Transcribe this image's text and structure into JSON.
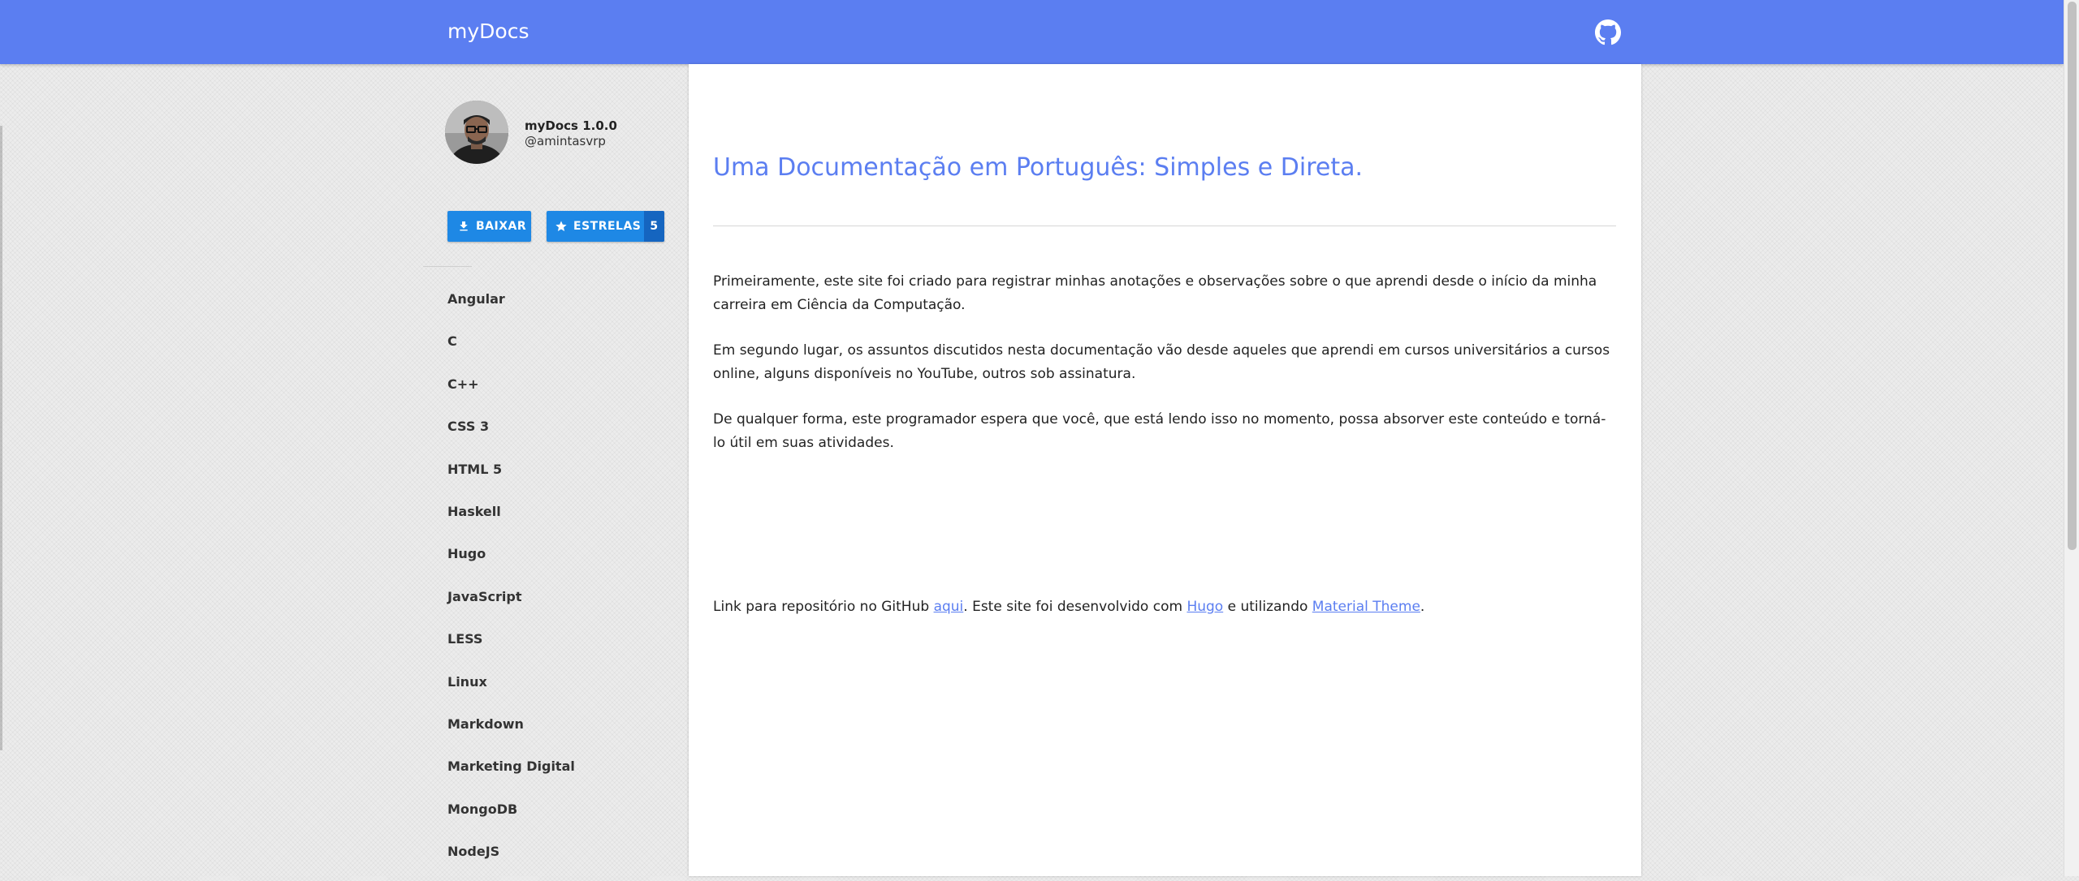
{
  "header": {
    "brand": "myDocs",
    "github_icon": "github-icon",
    "color": "#5b7ef1"
  },
  "sidebar": {
    "project_name": "myDocs 1.0.0",
    "project_user": "@amintasvrp",
    "download_label": "BAIXAR",
    "download_icon": "download-icon",
    "stars_label": "ESTRELAS",
    "stars_icon": "star-icon",
    "stars_count": "5",
    "button_color": "#1e88e5",
    "items": [
      {
        "label": "Angular"
      },
      {
        "label": "C"
      },
      {
        "label": "C++"
      },
      {
        "label": "CSS 3"
      },
      {
        "label": "HTML 5"
      },
      {
        "label": "Haskell"
      },
      {
        "label": "Hugo"
      },
      {
        "label": "JavaScript"
      },
      {
        "label": "LESS"
      },
      {
        "label": "Linux"
      },
      {
        "label": "Markdown"
      },
      {
        "label": "Marketing Digital"
      },
      {
        "label": "MongoDB"
      },
      {
        "label": "NodeJS"
      }
    ]
  },
  "main": {
    "title": "Uma Documentação em Português: Simples e Direta.",
    "p1": "Primeiramente, este site foi criado para registrar minhas anotações e observações sobre o que aprendi desde o início da minha carreira em Ciência da Computação.",
    "p2": "Em segundo lugar, os assuntos discutidos nesta documentação vão desde aqueles que aprendi em cursos universitários a cursos online, alguns disponíveis no YouTube, outros sob assinatura.",
    "p3": "De qualquer forma, este programador espera que você, que está lendo isso no momento, possa absorver este conteúdo e torná-lo útil em suas atividades.",
    "footer": {
      "text1": "Link para repositório no GitHub ",
      "link1": "aqui",
      "text2": ". Este site foi desenvolvido com ",
      "link2": "Hugo",
      "text3": " e utilizando ",
      "link3": "Material Theme",
      "text4": "."
    }
  }
}
